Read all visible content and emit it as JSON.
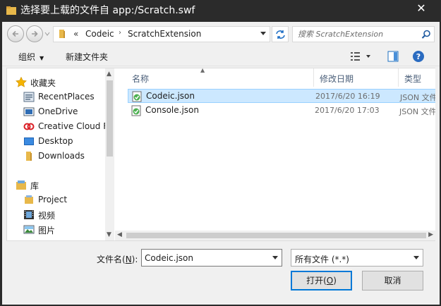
{
  "window": {
    "title": "选择要上载的文件自 app:/Scratch.swf",
    "close_glyph": "✕"
  },
  "address": {
    "overflow_glyph": "«",
    "segments": [
      "Codeic",
      "ScratchExtension"
    ],
    "separator": "›"
  },
  "search": {
    "placeholder": "搜索 ScratchExtension"
  },
  "toolbar": {
    "organize_label": "组织",
    "new_folder_label": "新建文件夹"
  },
  "navpane": {
    "items": [
      {
        "label": "收藏夹",
        "icon": "star-icon"
      },
      {
        "label": "RecentPlaces",
        "icon": "recent-places-icon"
      },
      {
        "label": "OneDrive",
        "icon": "onedrive-icon"
      },
      {
        "label": "Creative Cloud F",
        "icon": "creative-cloud-icon"
      },
      {
        "label": "Desktop",
        "icon": "desktop-icon"
      },
      {
        "label": "Downloads",
        "icon": "folder-icon"
      },
      {
        "label": "库",
        "icon": "library-icon"
      },
      {
        "label": "Project",
        "icon": "library-icon"
      },
      {
        "label": "视频",
        "icon": "video-icon"
      },
      {
        "label": "图片",
        "icon": "pictures-icon"
      }
    ]
  },
  "files": {
    "columns": {
      "name": "名称",
      "date": "修改日期",
      "type": "类型"
    },
    "rows": [
      {
        "name": "Codeic.json",
        "date": "2017/6/20 16:19",
        "type": "JSON 文件",
        "selected": true
      },
      {
        "name": "Console.json",
        "date": "2017/6/20 17:03",
        "type": "JSON 文件",
        "selected": false
      }
    ]
  },
  "footer": {
    "filename_label": "文件名(",
    "filename_hotkey": "N",
    "filename_label_end": "):",
    "filename_value": "Codeic.json",
    "filetype_value": "所有文件 (*.*)",
    "open_label": "打开(",
    "open_hotkey": "O",
    "open_label_end": ")",
    "cancel_label": "取消"
  },
  "colors": {
    "accent": "#0078d7",
    "selection": "#cce8ff",
    "selection_border": "#99d1ff",
    "titlebar": "#2b2b2b"
  }
}
